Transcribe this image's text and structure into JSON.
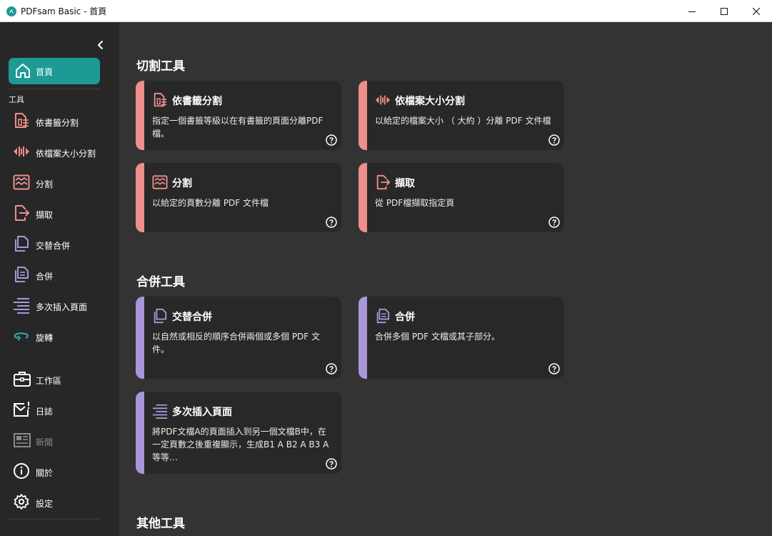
{
  "window": {
    "title": "PDFsam Basic - 首頁",
    "app_icon": "pdfsam-logo-icon",
    "controls": [
      "minimize-icon",
      "maximize-icon",
      "close-icon"
    ]
  },
  "sidebar": {
    "home": {
      "label": "首頁",
      "icon": "home-icon"
    },
    "tools_section_label": "工具",
    "tool_items": [
      {
        "label": "依書籤分割",
        "icon": "split-by-bookmarks-icon"
      },
      {
        "label": "依檔案大小分割",
        "icon": "split-by-size-icon"
      },
      {
        "label": "分割",
        "icon": "split-icon"
      },
      {
        "label": "擷取",
        "icon": "extract-icon"
      },
      {
        "label": "交替合併",
        "icon": "alternate-mix-icon"
      },
      {
        "label": "合併",
        "icon": "merge-icon"
      },
      {
        "label": "多次插入頁面",
        "icon": "insert-pages-icon"
      },
      {
        "label": "旋轉",
        "icon": "rotate-icon"
      }
    ],
    "app_items": [
      {
        "label": "工作區",
        "icon": "briefcase-icon"
      },
      {
        "label": "日誌",
        "icon": "log-mail-icon"
      },
      {
        "label": "新聞",
        "icon": "news-icon",
        "disabled": true
      },
      {
        "label": "關於",
        "icon": "info-icon"
      },
      {
        "label": "設定",
        "icon": "gear-icon"
      }
    ]
  },
  "colors": {
    "accent": "#1e9a96",
    "split_accent": "#ee8f8b",
    "merge_accent": "#a996d6",
    "rotate_accent": "#2ab3ad"
  },
  "main": {
    "split_section": {
      "title": "切割工具",
      "cards": [
        {
          "title": "依書籤分割",
          "description": "指定一個書籤等級以在有書籤的頁面分離PDF 檔。",
          "icon": "split-by-bookmarks-icon"
        },
        {
          "title": "依檔案大小分割",
          "description": "以給定的檔案大小 （ 大約 ）分離 PDF 文件檔",
          "icon": "split-by-size-icon"
        },
        {
          "title": "分割",
          "description": "以給定的頁數分離 PDF 文件檔",
          "icon": "split-icon"
        },
        {
          "title": "擷取",
          "description": "從 PDF檔擷取指定頁",
          "icon": "extract-icon"
        }
      ]
    },
    "merge_section": {
      "title": "合併工具",
      "cards": [
        {
          "title": "交替合併",
          "description": "以自然或相反的順序合併兩個或多個 PDF 文件。",
          "icon": "alternate-mix-icon"
        },
        {
          "title": "合併",
          "description": "合併多個 PDF 文檔或其子部分。",
          "icon": "merge-icon"
        },
        {
          "title": "多次插入頁面",
          "description": "將PDF文檔A的頁面插入到另一個文檔B中，在一定頁數之後重複顯示，生成B1 A B2 A B3 A等等…",
          "icon": "insert-pages-icon"
        }
      ]
    },
    "other_section": {
      "title": "其他工具"
    },
    "help_icon": "help-icon"
  }
}
